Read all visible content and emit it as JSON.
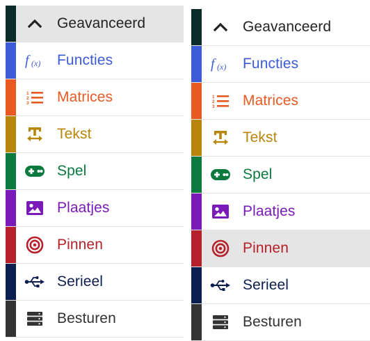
{
  "panels": [
    {
      "selected_index": 0,
      "items": [
        {
          "label": "Geavanceerd",
          "icon": "chevron-up-icon",
          "color": "#0b2a2a",
          "text_color": "#222222"
        },
        {
          "label": "Functies",
          "icon": "function-icon",
          "color": "#3c5bd6",
          "text_color": "#3c5bd6"
        },
        {
          "label": "Matrices",
          "icon": "list-numbered-icon",
          "color": "#e85a22",
          "text_color": "#e85a22"
        },
        {
          "label": "Tekst",
          "icon": "text-width-icon",
          "color": "#b8860b",
          "text_color": "#b8860b"
        },
        {
          "label": "Spel",
          "icon": "gamepad-icon",
          "color": "#0b7a3e",
          "text_color": "#0b7a3e"
        },
        {
          "label": "Plaatjes",
          "icon": "image-icon",
          "color": "#7a1ab8",
          "text_color": "#7a1ab8"
        },
        {
          "label": "Pinnen",
          "icon": "target-icon",
          "color": "#b5202a",
          "text_color": "#b5202a"
        },
        {
          "label": "Serieel",
          "icon": "usb-icon",
          "color": "#0b1e50",
          "text_color": "#0b1e50"
        },
        {
          "label": "Besturen",
          "icon": "server-icon",
          "color": "#333333",
          "text_color": "#333333"
        }
      ]
    },
    {
      "selected_index": 6,
      "items": [
        {
          "label": "Geavanceerd",
          "icon": "chevron-up-icon",
          "color": "#0b2a2a",
          "text_color": "#222222"
        },
        {
          "label": "Functies",
          "icon": "function-icon",
          "color": "#3c5bd6",
          "text_color": "#3c5bd6"
        },
        {
          "label": "Matrices",
          "icon": "list-numbered-icon",
          "color": "#e85a22",
          "text_color": "#e85a22"
        },
        {
          "label": "Tekst",
          "icon": "text-width-icon",
          "color": "#b8860b",
          "text_color": "#b8860b"
        },
        {
          "label": "Spel",
          "icon": "gamepad-icon",
          "color": "#0b7a3e",
          "text_color": "#0b7a3e"
        },
        {
          "label": "Plaatjes",
          "icon": "image-icon",
          "color": "#7a1ab8",
          "text_color": "#7a1ab8"
        },
        {
          "label": "Pinnen",
          "icon": "target-icon",
          "color": "#b5202a",
          "text_color": "#b5202a"
        },
        {
          "label": "Serieel",
          "icon": "usb-icon",
          "color": "#0b1e50",
          "text_color": "#0b1e50"
        },
        {
          "label": "Besturen",
          "icon": "server-icon",
          "color": "#333333",
          "text_color": "#333333"
        }
      ]
    }
  ]
}
